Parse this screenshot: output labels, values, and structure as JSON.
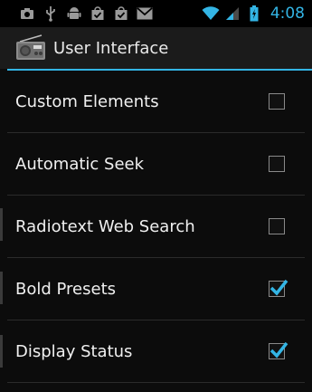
{
  "status_bar": {
    "time": "4:08",
    "icons": [
      "camera-icon",
      "usb-icon",
      "android-debug-icon",
      "shopping-bag-icon",
      "shopping-bag-icon",
      "gmail-icon",
      "wifi-icon",
      "signal-icon",
      "battery-icon"
    ]
  },
  "action_bar": {
    "title": "User Interface",
    "icon": "radio-icon"
  },
  "preferences": [
    {
      "label": "Custom Elements",
      "checked": false
    },
    {
      "label": "Automatic Seek",
      "checked": false
    },
    {
      "label": "Radiotext Web Search",
      "checked": false
    },
    {
      "label": "Bold Presets",
      "checked": true
    },
    {
      "label": "Display Status",
      "checked": true
    }
  ],
  "colors": {
    "accent": "#33b5e5",
    "background": "#0c0c0c",
    "text": "#f0f0f0"
  }
}
